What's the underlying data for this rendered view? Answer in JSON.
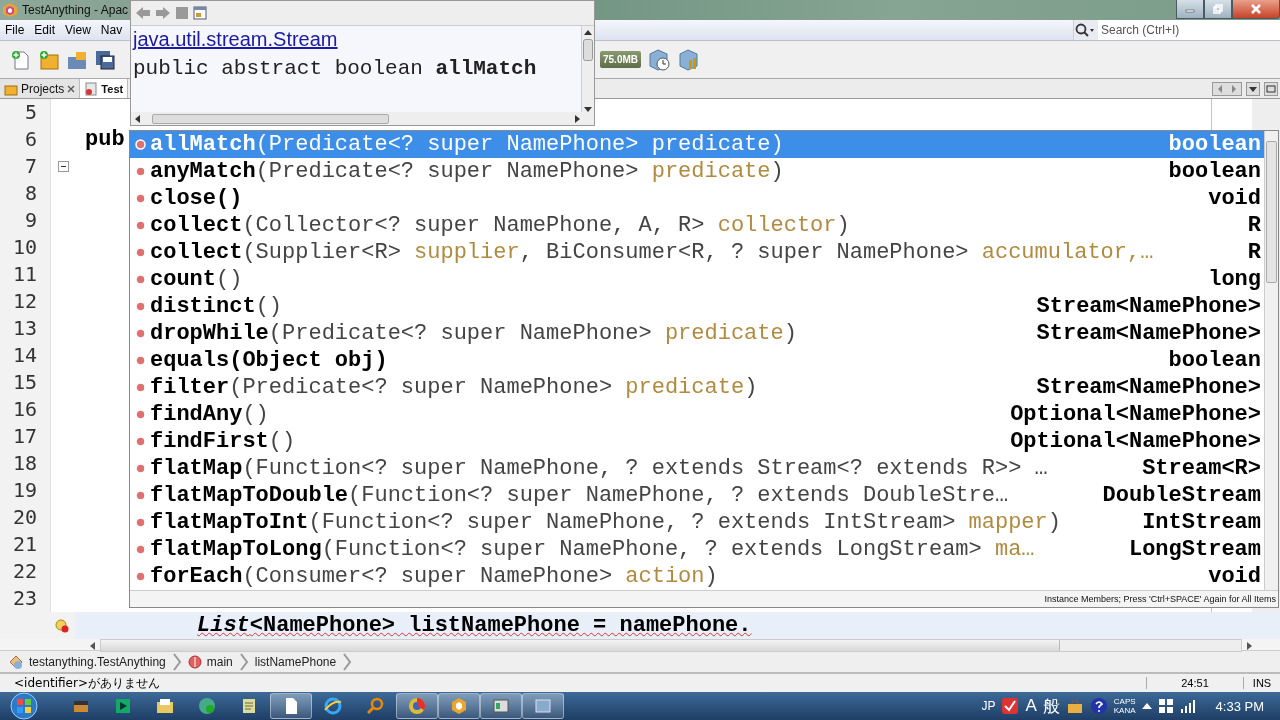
{
  "window": {
    "title": "TestAnything - Apac"
  },
  "menu": [
    "File",
    "Edit",
    "View",
    "Nav"
  ],
  "search": {
    "placeholder": "Search (Ctrl+I)"
  },
  "toolbar": {
    "memory": "75.0MB"
  },
  "tabs": [
    {
      "label": "Projects",
      "selected": false
    },
    {
      "label": "Test",
      "selected": true
    }
  ],
  "editor": {
    "lines": [
      {
        "number": "5",
        "foldable": false
      },
      {
        "number": "6",
        "code": "pub",
        "foldable": false
      },
      {
        "number": "7",
        "foldable": true
      },
      {
        "number": "8",
        "foldable": false
      },
      {
        "number": "9",
        "foldable": false
      },
      {
        "number": "10",
        "foldable": false
      },
      {
        "number": "11",
        "foldable": false
      },
      {
        "number": "12",
        "foldable": false
      },
      {
        "number": "13",
        "foldable": false
      },
      {
        "number": "14",
        "foldable": false
      },
      {
        "number": "15",
        "foldable": false
      },
      {
        "number": "16",
        "foldable": false
      },
      {
        "number": "17",
        "foldable": false
      },
      {
        "number": "18",
        "foldable": false
      },
      {
        "number": "19",
        "foldable": false
      },
      {
        "number": "20",
        "foldable": false
      },
      {
        "number": "21",
        "foldable": false
      },
      {
        "number": "22",
        "foldable": false
      },
      {
        "number": "23",
        "foldable": false
      }
    ],
    "current_line": "*List*<NamePhone> listNamePhone = namePhone."
  },
  "doc_popup": {
    "link": "java.util.stream.Stream",
    "signature": "public abstract boolean **allMatch**"
  },
  "completion": {
    "items": [
      {
        "name": "allMatch",
        "params": [
          {
            "kind": "type",
            "text": "(Predicate<? super NamePhone> "
          },
          {
            "kind": "param",
            "text": "predicate"
          },
          {
            "kind": "type",
            "text": ")"
          }
        ],
        "returns": "boolean",
        "selected": true
      },
      {
        "name": "anyMatch",
        "params": [
          {
            "kind": "type",
            "text": "(Predicate<? super NamePhone> "
          },
          {
            "kind": "param",
            "text": "predicate"
          },
          {
            "kind": "type",
            "text": ")"
          }
        ],
        "returns": "boolean",
        "selected": false
      },
      {
        "name": "close()",
        "returns": "void",
        "selected": false
      },
      {
        "name": "collect",
        "params": [
          {
            "kind": "type",
            "text": "(Collector<? super NamePhone, A, R> "
          },
          {
            "kind": "param",
            "text": "collector"
          },
          {
            "kind": "type",
            "text": ")"
          }
        ],
        "returns": "R",
        "selected": false
      },
      {
        "name": "collect",
        "params": [
          {
            "kind": "type",
            "text": "(Supplier<R> "
          },
          {
            "kind": "param",
            "text": "supplier"
          },
          {
            "kind": "type",
            "text": ", BiConsumer<R, ? super NamePhone> "
          },
          {
            "kind": "param",
            "text": "accumulator,…"
          }
        ],
        "returns": "R",
        "selected": false
      },
      {
        "name": "count",
        "params": [
          {
            "kind": "type",
            "text": "()"
          }
        ],
        "returns": "long",
        "selected": false
      },
      {
        "name": "distinct",
        "params": [
          {
            "kind": "type",
            "text": "()"
          }
        ],
        "returns": "Stream<NamePhone>",
        "selected": false
      },
      {
        "name": "dropWhile",
        "params": [
          {
            "kind": "type",
            "text": "(Predicate<? super NamePhone> "
          },
          {
            "kind": "param",
            "text": "predicate"
          },
          {
            "kind": "type",
            "text": ")"
          }
        ],
        "returns": "Stream<NamePhone>",
        "selected": false
      },
      {
        "name": "equals(Object obj)",
        "returns": "boolean",
        "selected": false
      },
      {
        "name": "filter",
        "params": [
          {
            "kind": "type",
            "text": "(Predicate<? super NamePhone> "
          },
          {
            "kind": "param",
            "text": "predicate"
          },
          {
            "kind": "type",
            "text": ")"
          }
        ],
        "returns": "Stream<NamePhone>",
        "selected": false
      },
      {
        "name": "findAny",
        "params": [
          {
            "kind": "type",
            "text": "()"
          }
        ],
        "returns": "Optional<NamePhone>",
        "selected": false
      },
      {
        "name": "findFirst",
        "params": [
          {
            "kind": "type",
            "text": "()"
          }
        ],
        "returns": "Optional<NamePhone>",
        "selected": false
      },
      {
        "name": "flatMap",
        "params": [
          {
            "kind": "type",
            "text": "(Function<? super NamePhone, ? extends Stream<? extends R>> …"
          }
        ],
        "returns": "Stream<R>",
        "selected": false
      },
      {
        "name": "flatMapToDouble",
        "params": [
          {
            "kind": "type",
            "text": "(Function<? super NamePhone, ? extends DoubleStre…"
          }
        ],
        "returns": "DoubleStream",
        "selected": false
      },
      {
        "name": "flatMapToInt",
        "params": [
          {
            "kind": "type",
            "text": "(Function<? super NamePhone, ? extends IntStream> "
          },
          {
            "kind": "param",
            "text": "mapper"
          },
          {
            "kind": "type",
            "text": ")"
          }
        ],
        "returns": "IntStream",
        "selected": false
      },
      {
        "name": "flatMapToLong",
        "params": [
          {
            "kind": "type",
            "text": "(Function<? super NamePhone, ? extends LongStream> "
          },
          {
            "kind": "param",
            "text": "ma…"
          }
        ],
        "returns": "LongStream",
        "selected": false
      },
      {
        "name": "forEach",
        "params": [
          {
            "kind": "type",
            "text": "(Consumer<? super NamePhone> "
          },
          {
            "kind": "param",
            "text": "action"
          },
          {
            "kind": "type",
            "text": ")"
          }
        ],
        "returns": "void",
        "selected": false
      }
    ],
    "footer": "Instance Members; Press 'Ctrl+SPACE' Again for All Items"
  },
  "breadcrumbs": [
    "testanything.TestAnything",
    "main",
    "listNamePhone"
  ],
  "status_bar": {
    "message": "<identifier>がありません",
    "position": "24:51",
    "mode": "INS"
  },
  "taskbar": {
    "language": "JP",
    "ime": [
      "A",
      "般"
    ],
    "keys": [
      "CAPS",
      "KANA"
    ],
    "clock": "4:33 PM"
  }
}
